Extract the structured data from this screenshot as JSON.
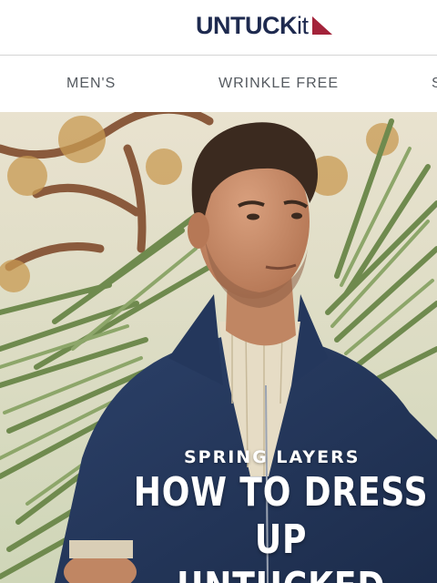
{
  "header": {
    "logo": {
      "text_main": "UNTUCK",
      "text_suffix": "it",
      "brand_color": "#1e2a4f",
      "flag_color": "#a3233a"
    }
  },
  "nav": {
    "items": [
      {
        "label": "MEN'S"
      },
      {
        "label": "WRINKLE FREE"
      },
      {
        "label": "S"
      }
    ],
    "text_color": "#555a60"
  },
  "hero": {
    "image": "man-in-navy-zip-jacket-palms",
    "eyebrow": "SPRING LAYERS",
    "title": "HOW TO DRESS UP\nUNTUCKED"
  }
}
